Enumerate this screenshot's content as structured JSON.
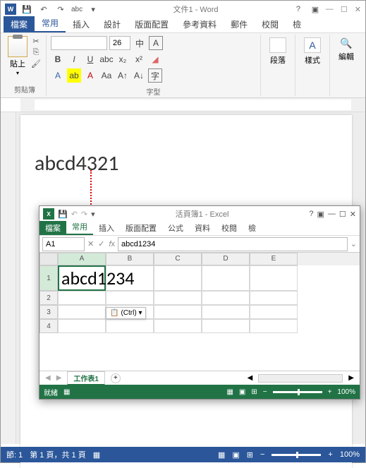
{
  "word": {
    "title": "文件1 - Word",
    "qat_typed": "abc",
    "tabs": {
      "file": "檔案",
      "home": "常用",
      "insert": "插入",
      "design": "設計",
      "layout": "版面配置",
      "ref": "參考資料",
      "mail": "郵件",
      "review": "校閱",
      "view": "檢"
    },
    "groups": {
      "clipboard": "剪貼簿",
      "font": "字型"
    },
    "paste": "貼上",
    "font_size": "26",
    "para_btn": "段落",
    "styles_btn": "樣式",
    "edit_btn": "編輯",
    "doc_text": "abcd4321",
    "status": {
      "section": "節: 1",
      "page": "第 1 頁，共 1 頁",
      "zoom": "100%"
    }
  },
  "excel": {
    "title": "活頁簿1 - Excel",
    "tabs": {
      "file": "檔案",
      "home": "常用",
      "insert": "插入",
      "layout": "版面配置",
      "formulas": "公式",
      "data": "資料",
      "review": "校閱",
      "view": "檢"
    },
    "namebox": "A1",
    "formula": "abcd1234",
    "cols": [
      "A",
      "B",
      "C",
      "D",
      "E"
    ],
    "rows": [
      "1",
      "2",
      "3",
      "4"
    ],
    "cell_a1": "abcd1234",
    "paste_opt": "(Ctrl) ▾",
    "sheet_tab": "工作表1",
    "status": {
      "ready": "就緒",
      "zoom": "100%"
    }
  }
}
